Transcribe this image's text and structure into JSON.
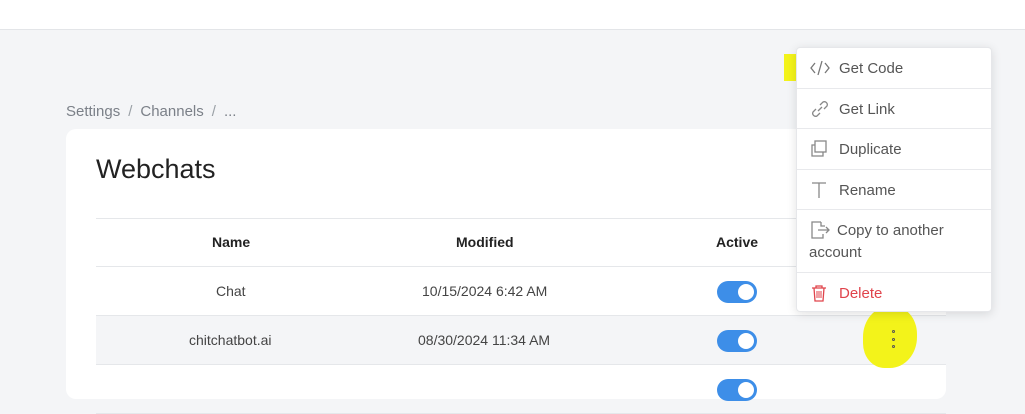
{
  "breadcrumb": {
    "items": [
      "Settings",
      "Channels",
      "..."
    ],
    "separator": "/"
  },
  "page": {
    "title": "Webchats"
  },
  "table": {
    "headers": {
      "name": "Name",
      "modified": "Modified",
      "active": "Active"
    },
    "rows": [
      {
        "name": "Chat",
        "modified": "10/15/2024 6:42 AM",
        "active": true
      },
      {
        "name": "chitchatbot.ai",
        "modified": "08/30/2024 11:34 AM",
        "active": true
      }
    ]
  },
  "context_menu": {
    "items": [
      {
        "label": "Get Code",
        "icon": "code-icon"
      },
      {
        "label": "Get Link",
        "icon": "link-icon"
      },
      {
        "label": "Duplicate",
        "icon": "duplicate-icon"
      },
      {
        "label": "Rename",
        "icon": "text-icon"
      },
      {
        "label": "Copy to another account",
        "icon": "copy-to-account-icon"
      },
      {
        "label": "Delete",
        "icon": "trash-icon"
      }
    ]
  },
  "colors": {
    "accent": "#3d8ee8",
    "highlight": "#f3f31a",
    "danger": "#e0434b"
  }
}
